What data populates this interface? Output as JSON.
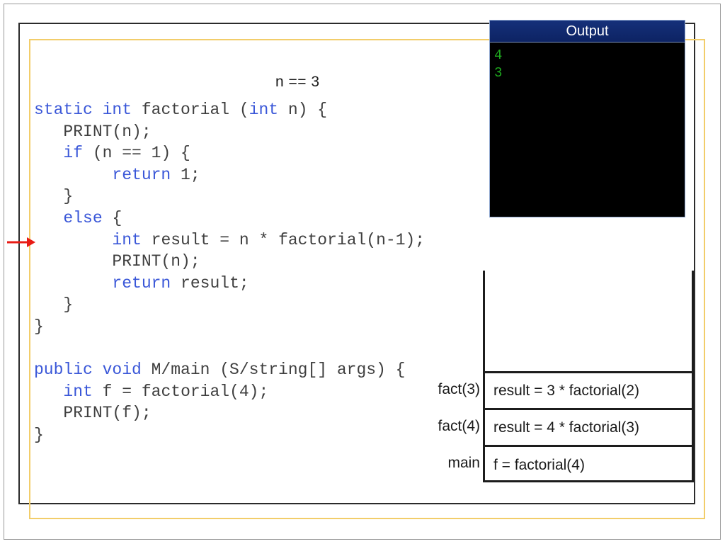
{
  "slide": {
    "annotation_label": "n == 3"
  },
  "code": {
    "language": "java",
    "lines": [
      [
        {
          "t": "static int",
          "k": true
        },
        {
          "t": " factorial (",
          "k": false
        },
        {
          "t": "int",
          "k": true
        },
        {
          "t": " n) {",
          "k": false
        }
      ],
      [
        {
          "t": "   PRINT(n);",
          "k": false
        }
      ],
      [
        {
          "t": "   ",
          "k": false
        },
        {
          "t": "if",
          "k": true
        },
        {
          "t": " (n == 1) {",
          "k": false
        }
      ],
      [
        {
          "t": "        ",
          "k": false
        },
        {
          "t": "return",
          "k": true
        },
        {
          "t": " 1;",
          "k": false
        }
      ],
      [
        {
          "t": "   }",
          "k": false
        }
      ],
      [
        {
          "t": "   ",
          "k": false
        },
        {
          "t": "else",
          "k": true
        },
        {
          "t": " {",
          "k": false
        }
      ],
      [
        {
          "t": "        ",
          "k": false
        },
        {
          "t": "int",
          "k": true
        },
        {
          "t": " result = n * factorial(n-1);",
          "k": false
        }
      ],
      [
        {
          "t": "        PRINT(n);",
          "k": false
        }
      ],
      [
        {
          "t": "        ",
          "k": false
        },
        {
          "t": "return",
          "k": true
        },
        {
          "t": " result;",
          "k": false
        }
      ],
      [
        {
          "t": "   }",
          "k": false
        }
      ],
      [
        {
          "t": "}",
          "k": false
        }
      ],
      [
        {
          "t": "",
          "k": false
        }
      ],
      [
        {
          "t": "public void",
          "k": true
        },
        {
          "t": " M/main (S/string[] args) {",
          "k": false
        }
      ],
      [
        {
          "t": "   ",
          "k": false
        },
        {
          "t": "int",
          "k": true
        },
        {
          "t": " f = factorial(4);",
          "k": false
        }
      ],
      [
        {
          "t": "   PRINT(f);",
          "k": false
        }
      ],
      [
        {
          "t": "}",
          "k": false
        }
      ]
    ]
  },
  "console": {
    "title": "Output",
    "lines": [
      "4",
      "3"
    ]
  },
  "call_stack": {
    "frames": [
      {
        "label": "fact(3)",
        "expression": "result = 3 * factorial(2)"
      },
      {
        "label": "fact(4)",
        "expression": "result = 4 * factorial(3)"
      },
      {
        "label": "main",
        "expression": "f = factorial(4)"
      }
    ]
  },
  "colors": {
    "keyword": "#3a57d8",
    "code_text": "#3f3f3f",
    "console_bg": "#000000",
    "console_text": "#1faa1f",
    "console_title_bg": "#10296b",
    "highlight_border": "#f2cd6a",
    "frame_border": "#2b2b2b",
    "pointer_arrow": "#e81b14"
  }
}
